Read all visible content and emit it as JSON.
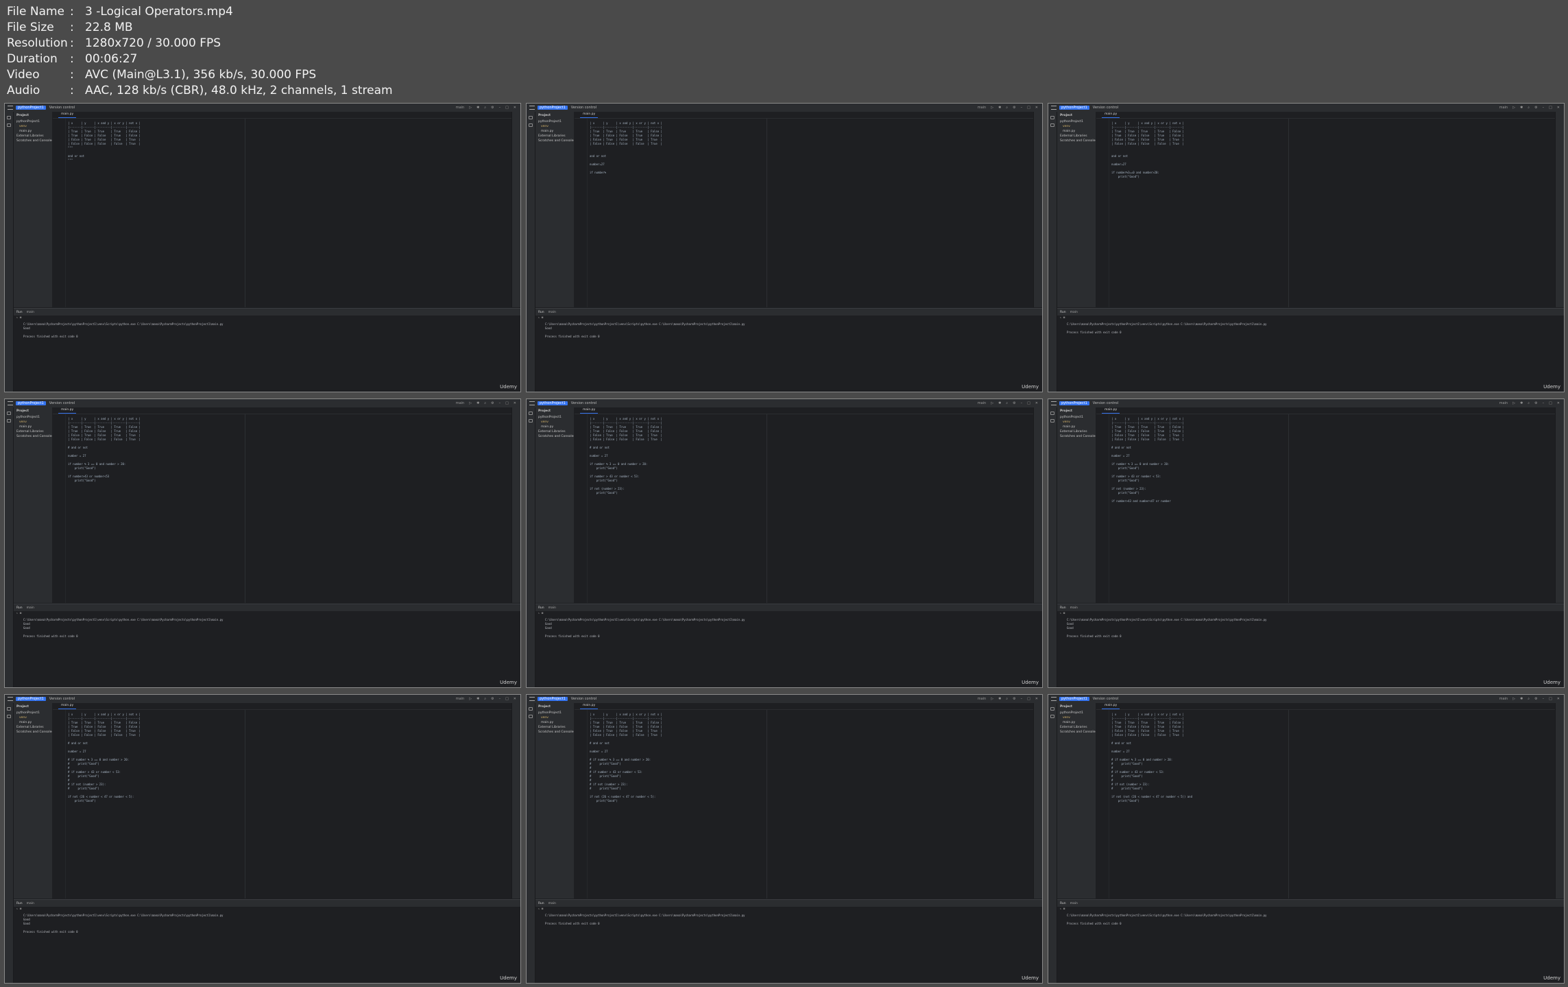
{
  "info": [
    {
      "label": "File Name",
      "value": "3 -Logical Operators.mp4"
    },
    {
      "label": "File Size",
      "value": "22.8 MB"
    },
    {
      "label": "Resolution",
      "value": "1280x720 / 30.000 FPS"
    },
    {
      "label": "Duration",
      "value": "00:06:27"
    },
    {
      "label": "Video",
      "value": "AVC (Main@L3.1), 356 kb/s, 30.000 FPS"
    },
    {
      "label": "Audio",
      "value": "AAC, 128 kb/s (CBR), 48.0 kHz, 2 channels, 1 stream"
    }
  ],
  "ide": {
    "project_name": "pythonProject1",
    "vcs_label": "Version control",
    "run_config": "main",
    "project_panel_title": "Project",
    "tree": [
      "pythonProject1",
      "venv",
      "main.py",
      "External Libraries",
      "Scratches and Consoles"
    ],
    "file_tab": "main.py",
    "run_tab_label": "Run",
    "run_config_tab": "main",
    "console_command": "C:\\Users\\mana\\PycharmProjects\\pythonProject1\\venv\\Scripts\\python.exe C:\\Users\\mana\\PycharmProjects\\pythonProject1\\main.py",
    "exit_message": "Process finished with exit code 0",
    "logo": "Udemy"
  },
  "thumbnails": [
    {
      "code": "| x     | y     | x and y | x or y | not x |\n|-------|-------|---------|--------|-------|\n| True  | True  | True    | True   | False |\n| True  | False | False   | True   | False |\n| False | True  | False   | True   | True  |\n| False | False | False   | False  | True  |\n\"\"\"\n\nand or not\n\"\"\"",
      "output": [
        "Good"
      ]
    },
    {
      "code": "| x     | y     | x and y | x or y | not x |\n|-------|-------|---------|--------|-------|\n| True  | True  | True    | True   | False |\n| True  | False | False   | True   | False |\n| False | True  | False   | True   | True  |\n| False | False | False   | False  | True  |\n\n\nand or not\n\nnumber=27\n\nif number%",
      "output": [
        "Good"
      ]
    },
    {
      "code": "| x     | y     | x and y | x or y | not x |\n|-------|-------|---------|--------|-------|\n| True  | True  | True    | True   | False |\n| True  | False | False   | True   | False |\n| False | True  | False   | True   | True  |\n| False | False | False   | False  | True  |\n\n\nand or not\n\nnumber=27\n\nif number%3==0 and number>20:\n    print(\"Good\")",
      "output": []
    },
    {
      "code": "| x     | y     | x and y | x or y | not x |\n|-------|-------|---------|--------|-------|\n| True  | True  | True    | True   | False |\n| True  | False | False   | True   | False |\n| False | True  | False   | True   | True  |\n| False | False | False   | False  | True  |\n\n# and or not\n\nnumber = 27\n\nif number % 3 == 0 and number > 20:\n    print(\"Good\")\n\nif number>43 or number<53\n    print(\"Good\")",
      "output": [
        "Good",
        "Good"
      ]
    },
    {
      "code": "| x     | y     | x and y | x or y | not x |\n|-------|-------|---------|--------|-------|\n| True  | True  | True    | True   | False |\n| True  | False | False   | True   | False |\n| False | True  | False   | True   | True  |\n| False | False | False   | False  | True  |\n\n# and or not\n\nnumber = 27\n\nif number % 3 == 0 and number > 20:\n    print(\"Good\")\n\nif number > 43 or number < 53:\n    print(\"Good\")\n\nif not (number > 23):\n    print(\"Good\")",
      "output": [
        "Good",
        "Good"
      ]
    },
    {
      "code": "| x     | y     | x and y | x or y | not x |\n|-------|-------|---------|--------|-------|\n| True  | True  | True    | True   | False |\n| True  | False | False   | True   | False |\n| False | True  | False   | True   | True  |\n| False | False | False   | False  | True  |\n\n# and or not\n\nnumber = 27\n\nif number % 3 == 0 and number > 20:\n    print(\"Good\")\n\nif number > 43 or number < 53:\n    print(\"Good\")\n\nif not (number > 23):\n    print(\"Good\")\n\nif number>43 and number<47 or number",
      "output": [
        "Good",
        "Good"
      ]
    },
    {
      "code": "| x     | y     | x and y | x or y | not x |\n|-------|-------|---------|--------|-------|\n| True  | True  | True    | True   | False |\n| True  | False | False   | True   | False |\n| False | True  | False   | True   | True  |\n| False | False | False   | False  | True  |\n\n# and or not\n\nnumber = 27\n\n# if number % 3 == 0 and number > 20:\n#     print(\"Good\")\n#\n# if number > 43 or number < 53:\n#     print(\"Good\")\n#\n# if not (number > 23):\n#     print(\"Good\")\n\nif not (26 < number < 47 or number < 5):\n    print(\"Good\")",
      "output": [
        "Good",
        "Good"
      ]
    },
    {
      "code": "| x     | y     | x and y | x or y | not x |\n|-------|-------|---------|--------|-------|\n| True  | True  | True    | True   | False |\n| True  | False | False   | True   | False |\n| False | True  | False   | True   | True  |\n| False | False | False   | False  | True  |\n\n# and or not\n\nnumber = 27\n\n# if number % 3 == 0 and number > 20:\n#     print(\"Good\")\n#\n# if number > 43 or number < 53:\n#     print(\"Good\")\n#\n# if not (number > 23):\n#     print(\"Good\")\n\nif not (26 < number < 47 or number < 5):\n    print(\"Good\")",
      "output": []
    },
    {
      "code": "| x     | y     | x and y | x or y | not x |\n|-------|-------|---------|--------|-------|\n| True  | True  | True    | True   | False |\n| True  | False | False   | True   | False |\n| False | True  | False   | True   | True  |\n| False | False | False   | False  | True  |\n\n# and or not\n\nnumber = 27\n\n# if number % 3 == 0 and number > 20:\n#     print(\"Good\")\n#\n# if number > 43 or number < 53:\n#     print(\"Good\")\n#\n# if not (number > 23):\n#     print(\"Good\")\n\nif not (not (26 < number < 47 or number < 5)) and\n    print(\"Good\")",
      "output": []
    }
  ]
}
